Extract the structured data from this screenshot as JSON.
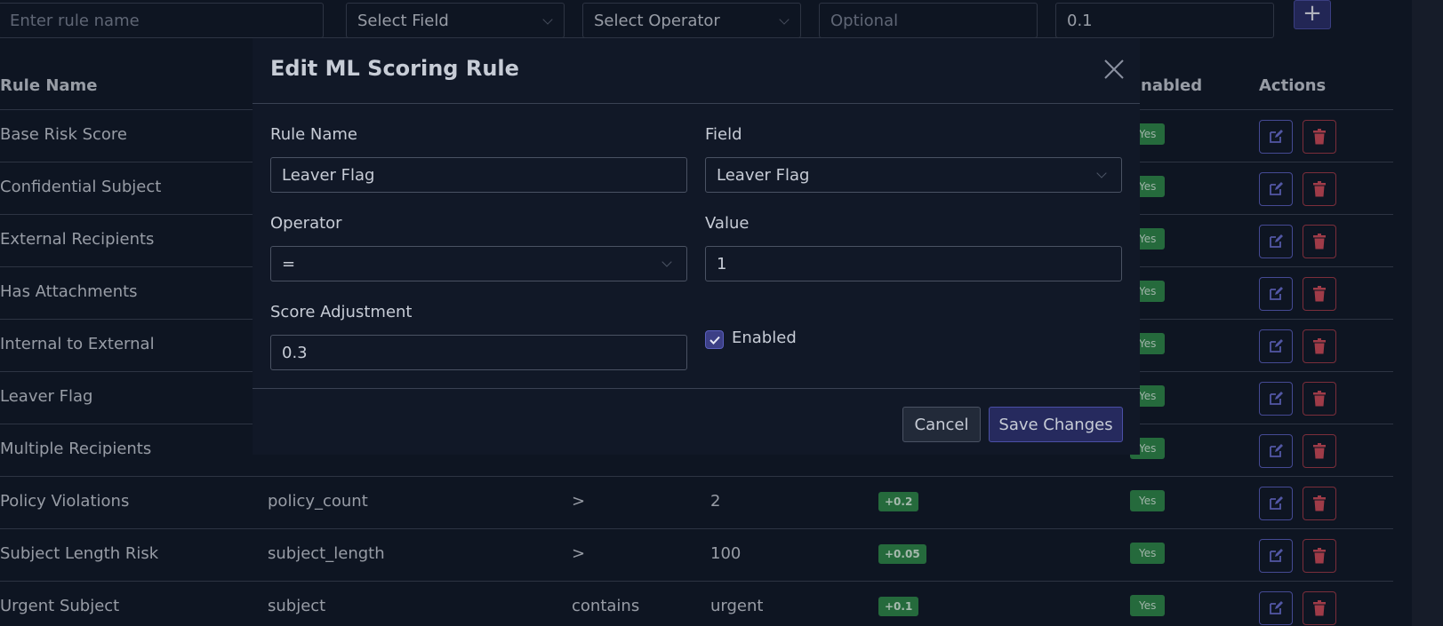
{
  "add_rule": {
    "name_placeholder": "Enter rule name",
    "field_select": "Select Field",
    "operator_select": "Select Operator",
    "value_placeholder": "Optional",
    "score_value": "0.1",
    "add_label": "+"
  },
  "table": {
    "headers": {
      "rule_name": "Rule Name",
      "enabled": "nabled",
      "actions": "Actions"
    },
    "rows": [
      {
        "name": "Base Risk Score",
        "field": "",
        "operator": "",
        "value": "",
        "score": "",
        "enabled": "Yes"
      },
      {
        "name": "Confidential Subject",
        "field": "",
        "operator": "",
        "value": "",
        "score": "",
        "enabled": "Yes"
      },
      {
        "name": "External Recipients",
        "field": "",
        "operator": "",
        "value": "",
        "score": "",
        "enabled": "Yes"
      },
      {
        "name": "Has Attachments",
        "field": "",
        "operator": "",
        "value": "",
        "score": "",
        "enabled": "Yes"
      },
      {
        "name": "Internal to External",
        "field": "",
        "operator": "",
        "value": "",
        "score": "",
        "enabled": "Yes"
      },
      {
        "name": "Leaver Flag",
        "field": "",
        "operator": "",
        "value": "",
        "score": "",
        "enabled": "Yes"
      },
      {
        "name": "Multiple Recipients",
        "field": "",
        "operator": "",
        "value": "",
        "score": "",
        "enabled": "Yes"
      },
      {
        "name": "Policy Violations",
        "field": "policy_count",
        "operator": ">",
        "value": "2",
        "score": "+0.2",
        "enabled": "Yes"
      },
      {
        "name": "Subject Length Risk",
        "field": "subject_length",
        "operator": ">",
        "value": "100",
        "score": "+0.05",
        "enabled": "Yes"
      },
      {
        "name": "Urgent Subject",
        "field": "subject",
        "operator": "contains",
        "value": "urgent",
        "score": "+0.1",
        "enabled": "Yes"
      }
    ]
  },
  "modal": {
    "title": "Edit ML Scoring Rule",
    "rule_name_label": "Rule Name",
    "rule_name_value": "Leaver Flag",
    "field_label": "Field",
    "field_value": "Leaver Flag",
    "operator_label": "Operator",
    "operator_value": "=",
    "value_label": "Value",
    "value_value": "1",
    "score_label": "Score Adjustment",
    "score_value": "0.3",
    "enabled_label": "Enabled",
    "enabled_checked": true,
    "cancel_label": "Cancel",
    "save_label": "Save Changes"
  },
  "colors": {
    "background": "#111827",
    "accent": "#4b4fa6",
    "success_badge": "#2f8a4a",
    "danger": "#a23a48"
  },
  "icons": {
    "edit": "edit-icon",
    "delete": "trash-icon",
    "close": "close-icon",
    "check": "check-icon"
  }
}
